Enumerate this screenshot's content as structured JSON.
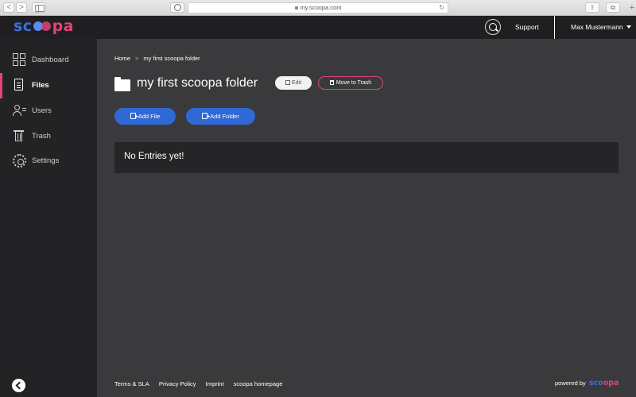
{
  "browser": {
    "url": "my.scoopa.com",
    "back_icon": "<",
    "forward_icon": ">",
    "reload_icon": "↻",
    "share_icon": "⇪",
    "tabs_icon": "⧉",
    "new_tab_icon": "+"
  },
  "header": {
    "logo": {
      "part1": "sc",
      "part2": "pa"
    },
    "support_label": "Support",
    "user_name": "Max Mustermann"
  },
  "sidebar": {
    "items": [
      {
        "label": "Dashboard",
        "icon": "dashboard-grid-icon"
      },
      {
        "label": "Files",
        "icon": "file-icon",
        "active": true
      },
      {
        "label": "Users",
        "icon": "users-icon"
      },
      {
        "label": "Trash",
        "icon": "trash-icon"
      },
      {
        "label": "Settings",
        "icon": "gear-icon"
      }
    ]
  },
  "main": {
    "breadcrumb": {
      "home": "Home",
      "separator": ">",
      "current": "my first scoopa folder"
    },
    "title": "my first scoopa folder",
    "edit_label": "Edit",
    "trash_label": "Move to Trash",
    "add_file_label": "Add File",
    "add_folder_label": "Add Folder",
    "empty_message": "No Entries yet!"
  },
  "footer": {
    "links": [
      "Terms & SLA",
      "Privacy Policy",
      "Imprint",
      "scoopa homepage"
    ],
    "powered_by": "powered by",
    "logo": {
      "part1": "sc",
      "part2": "pa"
    }
  },
  "colors": {
    "accent_blue": "#2f69d6",
    "accent_pink": "#e0447a",
    "sidebar_bg": "#232325",
    "content_bg": "#3a3a3c"
  }
}
